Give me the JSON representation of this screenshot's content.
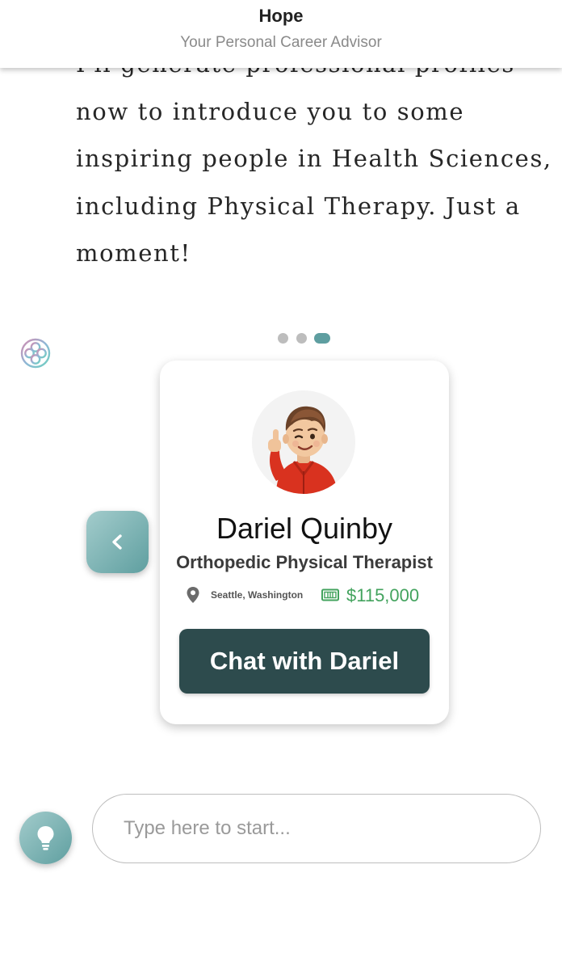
{
  "header": {
    "title": "Hope",
    "subtitle": "Your Personal Career Advisor"
  },
  "message": {
    "lines": [
      "I'll generate professional profiles",
      "now to introduce you to some",
      "inspiring people in Health Sciences,",
      "including Physical Therapy. Just a",
      "moment!"
    ]
  },
  "carousel": {
    "page_count": 3,
    "active_page": 3,
    "prev_icon": "chevron-left-icon"
  },
  "profile": {
    "name": "Dariel Quinby",
    "role": "Orthopedic Physical Therapist",
    "location": "Seattle, Washington",
    "location_icon": "map-pin-icon",
    "salary": "$115,000",
    "salary_icon": "money-bill-icon",
    "chat_label": "Chat with Dariel"
  },
  "composer": {
    "placeholder": "Type here to start...",
    "hint_icon": "lightbulb-icon"
  },
  "colors": {
    "accent": "#5e9ea0",
    "button_dark": "#2d4b4d",
    "salary_green": "#43a35e"
  }
}
